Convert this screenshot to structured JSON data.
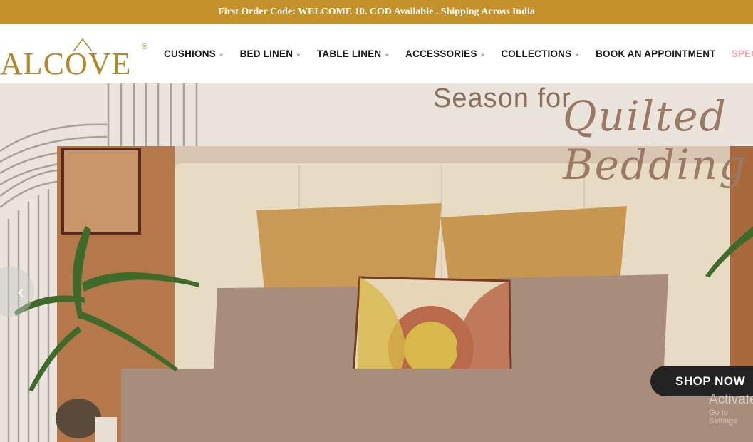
{
  "announcement": {
    "text": "First Order Code: WELCOME 10. COD Available . Shipping Across India"
  },
  "logo": {
    "text": "ALCOVE",
    "reg": "®"
  },
  "nav": {
    "items": [
      {
        "label": "CUSHIONS",
        "dropdown": true
      },
      {
        "label": "BED LINEN",
        "dropdown": true
      },
      {
        "label": "TABLE LINEN",
        "dropdown": true
      },
      {
        "label": "ACCESSORIES",
        "dropdown": true
      },
      {
        "label": "COLLECTIONS",
        "dropdown": true
      },
      {
        "label": "BOOK AN APPOINTMENT",
        "dropdown": false
      },
      {
        "label": "SPECIAL PRICES",
        "dropdown": false
      }
    ],
    "chevron": "⌄"
  },
  "hero": {
    "headline": "Season for",
    "script": "Quilted Bedding",
    "cta": "SHOP NOW",
    "prev_arrow": "‹",
    "watermark_line1": "Activate",
    "watermark_line2": "Go to Settings"
  },
  "colors": {
    "gold": "#c4912a",
    "logo": "#b08a2a",
    "special": "#f0a8b0",
    "hero_bg": "#ebe4dd"
  }
}
